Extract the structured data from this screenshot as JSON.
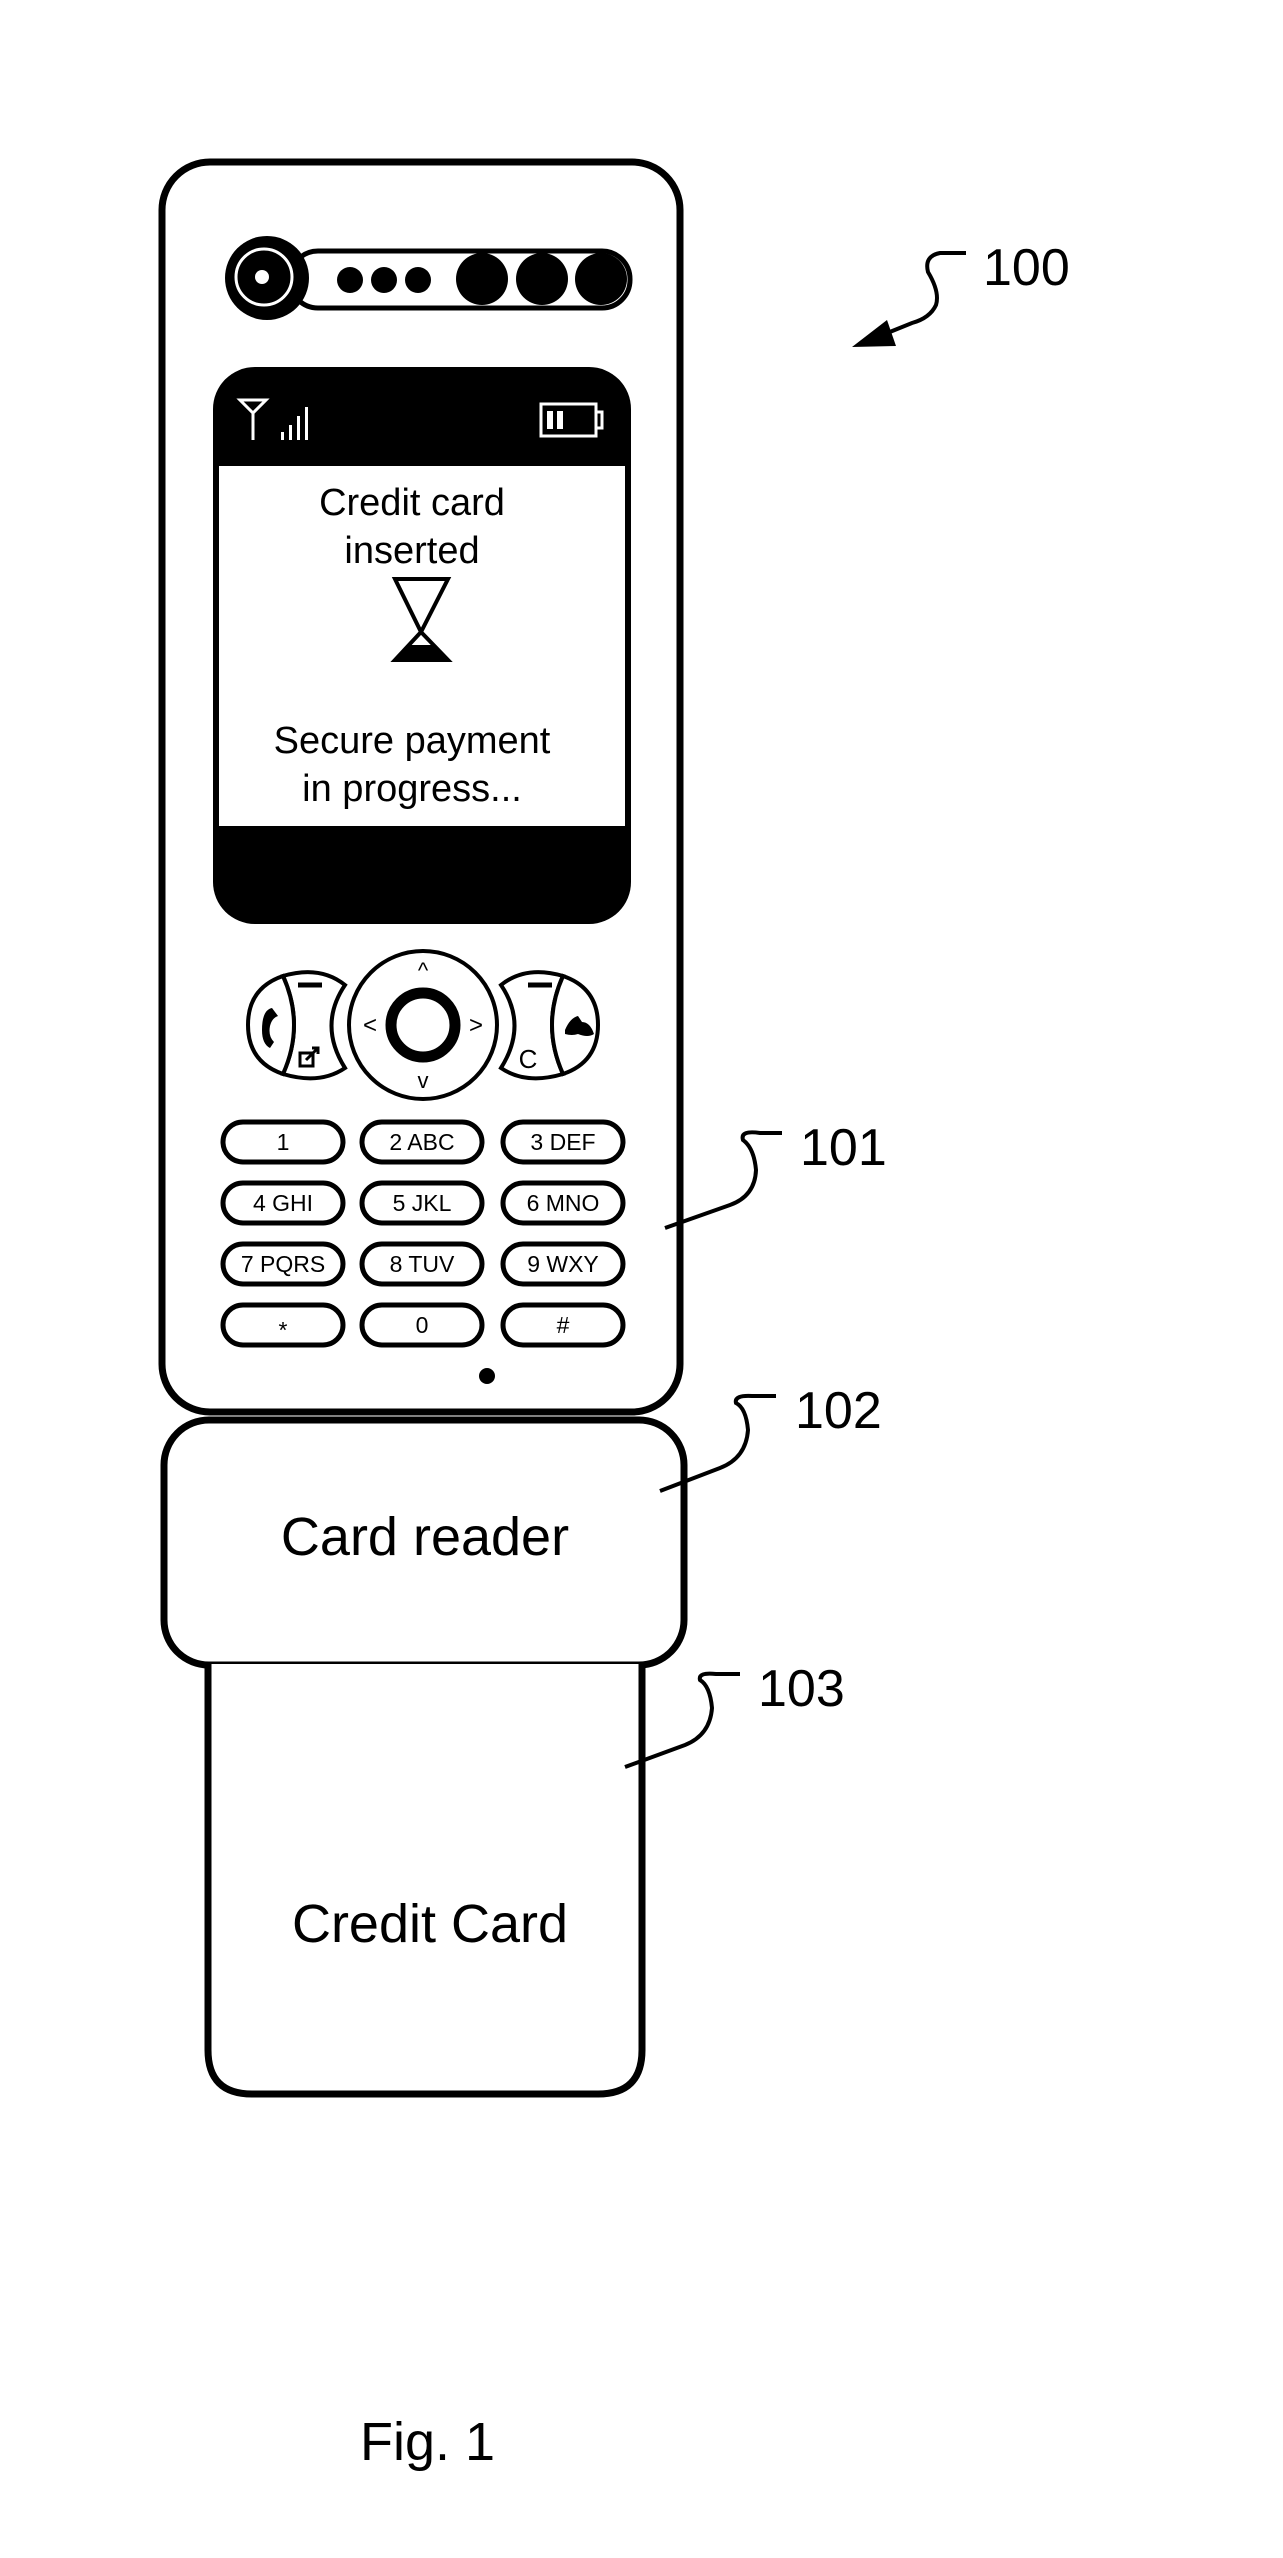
{
  "figure": {
    "caption": "Fig. 1",
    "reference_labels": {
      "device": "100",
      "phone": "101",
      "card_reader": "102",
      "credit_card": "103"
    }
  },
  "phone": {
    "status_bar": {
      "icons": [
        "antenna-icon",
        "signal-strength-icon",
        "battery-icon"
      ]
    },
    "screen": {
      "line1": "Credit card",
      "line2": "inserted",
      "status_icon": "hourglass-icon",
      "line3": "Secure payment",
      "line4": "in progress..."
    },
    "nav": {
      "up": "^",
      "down": "v",
      "left": "<",
      "right": ">",
      "clear_key": "C",
      "icons": [
        "call-icon",
        "menu-shortcut-icon",
        "end-call-icon",
        "softkey-left-icon",
        "softkey-right-icon"
      ]
    },
    "keypad": [
      [
        "1",
        "2 ABC",
        "3 DEF"
      ],
      [
        "4 GHI",
        "5 JKL",
        "6 MNO"
      ],
      [
        "7 PQRS",
        "8 TUV",
        "9 WXY"
      ],
      [
        "*",
        "0",
        "#"
      ]
    ]
  },
  "card_reader": {
    "label": "Card reader"
  },
  "credit_card": {
    "label": "Credit Card"
  }
}
